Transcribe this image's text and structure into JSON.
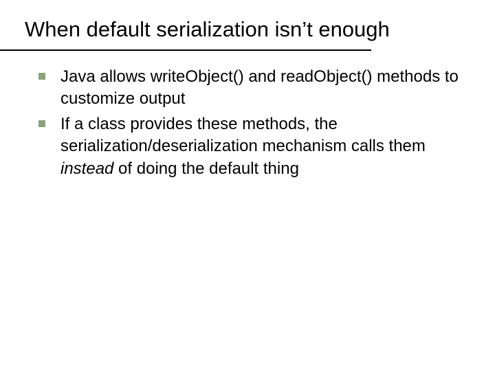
{
  "title": "When default serialization isn’t enough",
  "bullets": [
    {
      "segments": [
        {
          "text": "Java allows writeObject() and readObject() methods to customize output",
          "italic": false
        }
      ]
    },
    {
      "segments": [
        {
          "text": "If a class provides these methods, the serialization/deserialization mechanism calls them ",
          "italic": false
        },
        {
          "text": "instead",
          "italic": true
        },
        {
          "text": " of doing the default thing",
          "italic": false
        }
      ]
    }
  ]
}
